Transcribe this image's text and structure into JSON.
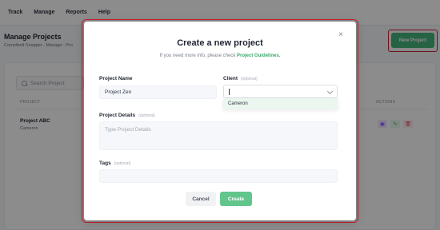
{
  "nav": {
    "items": [
      "Track",
      "Manage",
      "Reports",
      "Help"
    ]
  },
  "header": {
    "title": "Manage Projects",
    "breadcrumb": "Cornetbolt Snapper - Manage - Pro",
    "new_project_label": "New Project"
  },
  "table": {
    "search_placeholder": "Search Project",
    "col_project": "PROJECT",
    "col_actions": "ACTIONS",
    "row": {
      "title": "Project ABC",
      "subtitle": "Cameron"
    }
  },
  "modal": {
    "title": "Create a new project",
    "subtitle_prefix": "If you need more info, please check ",
    "subtitle_link": "Project Guidelines.",
    "fields": {
      "project_name_label": "Project Name",
      "project_name_value": "Project Zen",
      "client_label": "Client",
      "client_optional": "(optional)",
      "client_option": "Cameron",
      "details_label": "Project Details",
      "details_optional": "(optional)",
      "details_placeholder": "Type Project Details",
      "tags_label": "Tags",
      "tags_optional": "(optional)"
    },
    "buttons": {
      "cancel": "Cancel",
      "create": "Create"
    }
  },
  "colors": {
    "accent_green": "#45b27d",
    "create_green": "#62c58b",
    "highlight_red": "#c8202c"
  }
}
